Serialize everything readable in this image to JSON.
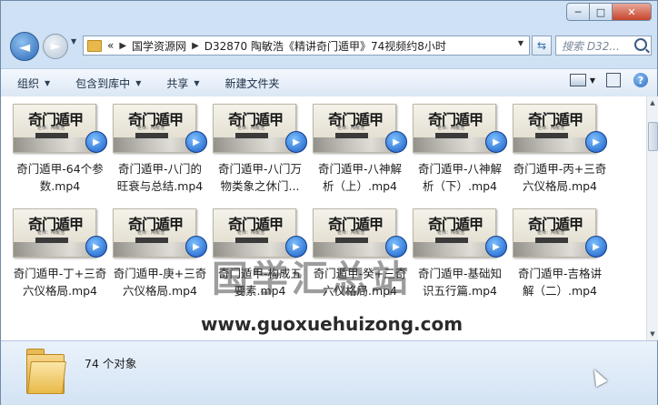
{
  "window": {
    "controls": {
      "minimize": "─",
      "maximize": "□",
      "close": "✕"
    }
  },
  "nav": {
    "back_icon": "◄",
    "forward_icon": "►",
    "breadcrumbs": [
      "«",
      "国学资源网",
      "D32870 陶敏浩《精讲奇门遁甲》74视频约8小时"
    ],
    "search_placeholder": "搜索 D32..."
  },
  "toolbar": {
    "organize": "组织",
    "include_library": "包含到库中",
    "share": "共享",
    "new_folder": "新建文件夹"
  },
  "thumbnail": {
    "title": "奇门遁甲",
    "subtitle": "老师：陶敏浩"
  },
  "files": [
    {
      "name": "奇门遁甲-64个参数.mp4"
    },
    {
      "name": "奇门遁甲-八门的旺衰与总结.mp4"
    },
    {
      "name": "奇门遁甲-八门万物类象之休门..."
    },
    {
      "name": "奇门遁甲-八神解析（上）.mp4"
    },
    {
      "name": "奇门遁甲-八神解析（下）.mp4"
    },
    {
      "name": "奇门遁甲-丙+三奇六仪格局.mp4"
    },
    {
      "name": "奇门遁甲-丁+三奇六仪格局.mp4"
    },
    {
      "name": "奇门遁甲-庚+三奇六仪格局.mp4"
    },
    {
      "name": "奇门遁甲-构成五要素.mp4"
    },
    {
      "name": "奇门遁甲-癸+三奇六仪格局.mp4"
    },
    {
      "name": "奇门遁甲-基础知识五行篇.mp4"
    },
    {
      "name": "奇门遁甲-吉格讲解（二）.mp4"
    }
  ],
  "watermark": {
    "cn": "国学汇总站",
    "url": "www.guoxuehuizong.com"
  },
  "details": {
    "count": "74 个对象"
  }
}
